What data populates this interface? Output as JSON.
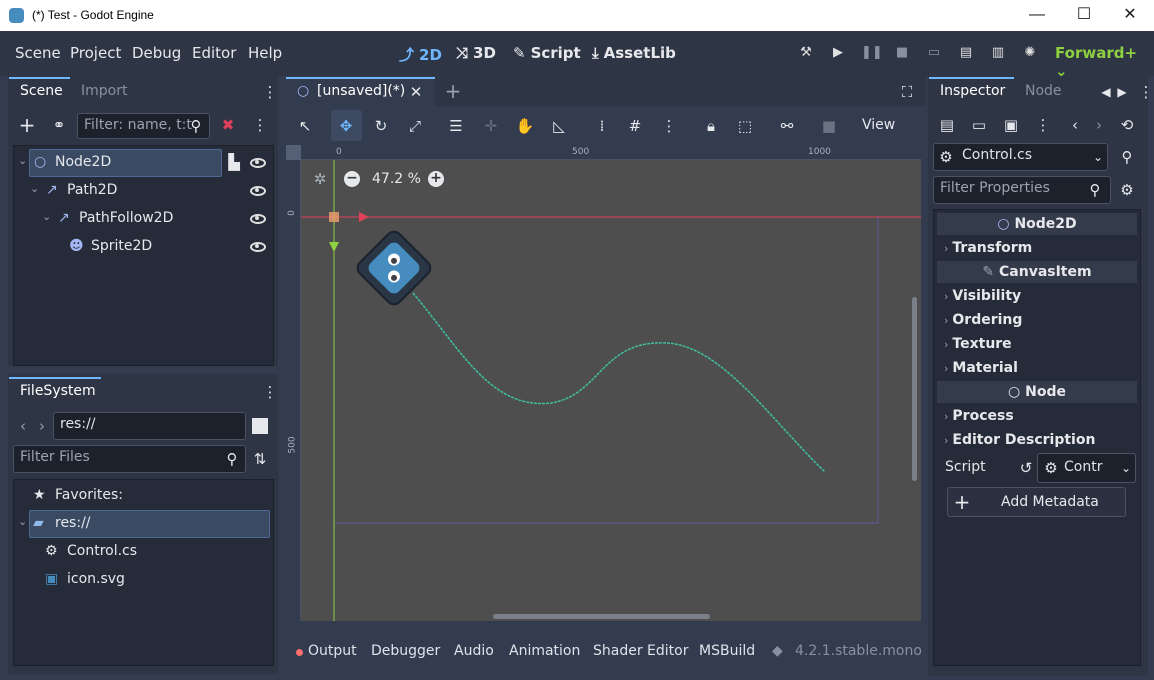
{
  "window": {
    "title": "(*) Test - Godot Engine",
    "controls": [
      "—",
      "☐",
      "✕"
    ]
  },
  "menu": [
    "Scene",
    "Project",
    "Debug",
    "Editor",
    "Help"
  ],
  "workspaces": [
    {
      "label": "2D",
      "icon": "⤴",
      "active": true
    },
    {
      "label": "3D",
      "icon": "⤨",
      "active": false
    },
    {
      "label": "Script",
      "icon": "✎",
      "active": false
    },
    {
      "label": "AssetLib",
      "icon": "⤓",
      "active": false
    }
  ],
  "renderer": "Forward+",
  "scene_dock": {
    "tabs": [
      "Scene",
      "Import"
    ],
    "filter_placeholder": "Filter: name, t:t",
    "nodes": [
      {
        "label": "Node2D",
        "icon": "○"
      },
      {
        "label": "Path2D",
        "icon": "↗"
      },
      {
        "label": "PathFollow2D",
        "icon": "↗"
      },
      {
        "label": "Sprite2D",
        "icon": "☻"
      }
    ]
  },
  "filesystem": {
    "title": "FileSystem",
    "path": "res://",
    "filter_placeholder": "Filter Files",
    "favorites": "Favorites:",
    "items": [
      {
        "label": "res://",
        "icon": "▰"
      },
      {
        "label": "Control.cs",
        "icon": "⚙"
      },
      {
        "label": "icon.svg",
        "icon": "▣"
      }
    ]
  },
  "editor": {
    "tab_label": "[unsaved](*)",
    "view_menu": "View",
    "zoom": "47.2 %",
    "ruler_x": [
      "0",
      "500",
      "1000"
    ],
    "ruler_y": [
      "0",
      "500"
    ]
  },
  "inspector": {
    "tabs": [
      "Inspector",
      "Node"
    ],
    "resource": "Control.cs",
    "filter_placeholder": "Filter Properties",
    "sections": [
      {
        "type": "header",
        "label": "Node2D",
        "icon": "○"
      },
      {
        "type": "group",
        "label": "Transform"
      },
      {
        "type": "header",
        "label": "CanvasItem",
        "icon": "✎"
      },
      {
        "type": "group",
        "label": "Visibility"
      },
      {
        "type": "group",
        "label": "Ordering"
      },
      {
        "type": "group",
        "label": "Texture"
      },
      {
        "type": "group",
        "label": "Material"
      },
      {
        "type": "header",
        "label": "Node",
        "icon": "○"
      },
      {
        "type": "group",
        "label": "Process"
      },
      {
        "type": "group",
        "label": "Editor Description"
      }
    ],
    "script_label": "Script",
    "script_value": "Contr",
    "add_metadata": "Add Metadata"
  },
  "bottom_panel": {
    "tabs": [
      "Output",
      "Debugger",
      "Audio",
      "Animation",
      "Shader Editor",
      "MSBuild"
    ],
    "version": "4.2.1.stable.mono"
  },
  "colors": {
    "accent": "#6fb7ff",
    "x_axis": "#e0405a",
    "y_axis": "#8fd040",
    "path": "#40c0a0",
    "godot_blue": "#478cbf"
  }
}
